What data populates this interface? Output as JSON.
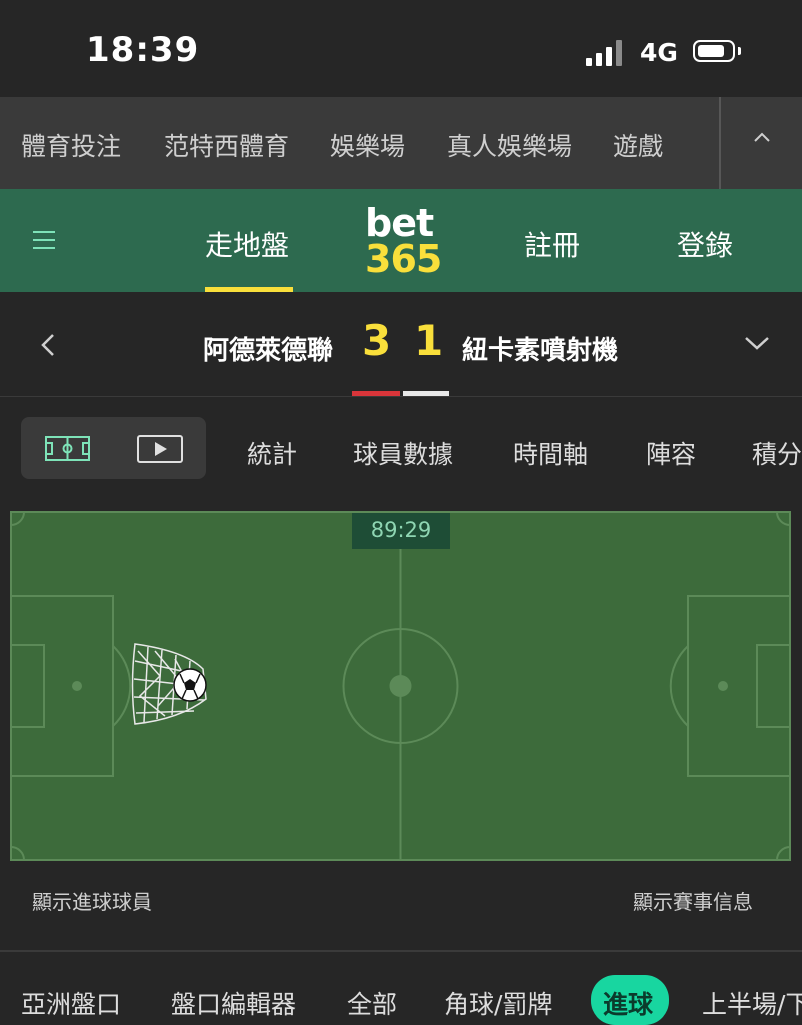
{
  "status_bar": {
    "time": "18:39",
    "network": "4G",
    "battery_level": 0.8
  },
  "top_nav": {
    "items": [
      "體育投注",
      "范特西體育",
      "娛樂場",
      "真人娛樂場",
      "遊戲"
    ],
    "collapse_icon": "chevron-up-icon"
  },
  "header": {
    "menu_icon": "hamburger-icon",
    "in_play": "走地盤",
    "logo": {
      "top": "bet",
      "bottom": "365"
    },
    "register": "註冊",
    "login": "登錄",
    "accent_color": "#f9df3b",
    "brand_color": "#2d6a4f"
  },
  "match": {
    "home_team": "阿德萊德聯",
    "home_score": "3",
    "away_score": "1",
    "away_team": "紐卡素噴射機",
    "home_kit_color": "#d9353a",
    "away_kit_color": "#e8e8e8"
  },
  "tabs": {
    "view_icons": [
      "pitch-icon",
      "video-icon"
    ],
    "items": [
      "統計",
      "球員數據",
      "時間軸",
      "陣容",
      "積分"
    ]
  },
  "pitch": {
    "clock": "89:29",
    "event": "goal"
  },
  "info": {
    "show_scorers": "顯示進球球員",
    "show_match_info": "顯示賽事信息"
  },
  "markets": {
    "items": [
      "亞洲盤口",
      "盤口編輯器",
      "全部",
      "角球/罰牌",
      "進球",
      "上半場/下"
    ],
    "active": "進球"
  }
}
